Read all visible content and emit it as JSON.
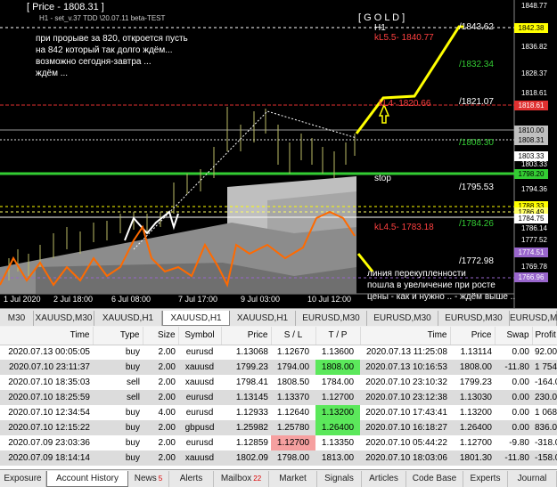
{
  "chart": {
    "header": "[ Price - 1808.31 ]",
    "subheader": "H1 - set_v.37 TDD \\20.07.11 beta-TEST",
    "symbol": "[ G O L D ]",
    "timeframe": "H1",
    "comment_lines": [
      "при прорыве за 820, откроется пусть",
      "на 842 который так долго ждём...",
      "возможно сегодня-завтра ...",
      "ждём ..."
    ],
    "bottom_comment_lines": [
      "линия перекупленности",
      "пошла в увеличение при росте",
      "цены - как и нужно .. - ждём выше .."
    ],
    "stop_label": "stop",
    "levels": [
      {
        "text": "kL5.5- 1840.77",
        "color": "#ff4040"
      },
      {
        "text": "/1843.62",
        "color": "#ffffff"
      },
      {
        "text": "/1832.34",
        "color": "#33cc33"
      },
      {
        "text": "kL4- 1820.66",
        "color": "#ff4040"
      },
      {
        "text": "/1821.07",
        "color": "#ffffff"
      },
      {
        "text": "/1808.30",
        "color": "#33cc33"
      },
      {
        "text": "/1795.53",
        "color": "#ffffff"
      },
      {
        "text": "kL4.5- 1783.18",
        "color": "#ff4040"
      },
      {
        "text": "/1784.26",
        "color": "#33cc33"
      },
      {
        "text": "/1772.98",
        "color": "#ffffff"
      }
    ],
    "price_axis": [
      "1848.77",
      "1836.82",
      "1828.37",
      "1818.61",
      "1803.33",
      "1794.36",
      "1786.14",
      "1777.52",
      "1769.78"
    ],
    "price_boxes": [
      {
        "text": "1842.38",
        "bg": "#ffff00"
      },
      {
        "text": "1818.61",
        "bg": "#e03030"
      },
      {
        "text": "1810.00",
        "bg": "#c0c0c0"
      },
      {
        "text": "1808.31",
        "bg": "#c0c0c0"
      },
      {
        "text": "1803.33",
        "bg": "#ffffff"
      },
      {
        "text": "1798.20",
        "bg": "#33cc33"
      },
      {
        "text": "1788.33",
        "bg": "#ffff00"
      },
      {
        "text": "1786.49",
        "bg": "#ffff66"
      },
      {
        "text": "1784.75",
        "bg": "#ffffff"
      },
      {
        "text": "1774.51",
        "bg": "#9966cc"
      },
      {
        "text": "1766.96",
        "bg": "#9966cc"
      }
    ],
    "time_axis": [
      "1 Jul 2020",
      "2 Jul 18:00",
      "6 Jul 08:00",
      "7 Jul 17:00",
      "9 Jul 03:00",
      "10 Jul 12:00"
    ]
  },
  "chart_tabs": [
    {
      "label": "M30",
      "active": false
    },
    {
      "label": "XAUUSD,M30",
      "active": false
    },
    {
      "label": "XAUUSD,H1",
      "active": false
    },
    {
      "label": "XAUUSD,H1",
      "active": true
    },
    {
      "label": "XAUUSD,H1",
      "active": false
    },
    {
      "label": "EURUSD,M30",
      "active": false
    },
    {
      "label": "EURUSD,M30",
      "active": false
    },
    {
      "label": "EURUSD,M30",
      "active": false
    },
    {
      "label": "EURUSD,M3",
      "active": false
    }
  ],
  "history": {
    "columns": [
      "Time",
      "Type",
      "Size",
      "Symbol",
      "Price",
      "S / L",
      "T / P",
      "Time",
      "Price",
      "Swap",
      "Profit"
    ],
    "rows": [
      [
        "2020.07.13 00:05:05",
        "buy",
        "2.00",
        "eurusd",
        "1.13068",
        "1.12670",
        "1.13600",
        "2020.07.13 11:25:08",
        "1.13114",
        "0.00",
        "92.00"
      ],
      [
        "2020.07.10 23:11:37",
        "buy",
        "2.00",
        "xauusd",
        "1799.23",
        "1794.00",
        "1808.00",
        "2020.07.13 10:16:53",
        "1808.00",
        "-11.80",
        "1 754.00"
      ],
      [
        "2020.07.10 18:35:03",
        "sell",
        "2.00",
        "xauusd",
        "1798.41",
        "1808.50",
        "1784.00",
        "2020.07.10 23:10:32",
        "1799.23",
        "0.00",
        "-164.00"
      ],
      [
        "2020.07.10 18:25:59",
        "sell",
        "2.00",
        "eurusd",
        "1.13145",
        "1.13370",
        "1.12700",
        "2020.07.10 23:12:38",
        "1.13030",
        "0.00",
        "230.00"
      ],
      [
        "2020.07.10 12:34:54",
        "buy",
        "4.00",
        "eurusd",
        "1.12933",
        "1.12640",
        "1.13200",
        "2020.07.10 17:43:41",
        "1.13200",
        "0.00",
        "1 068.00"
      ],
      [
        "2020.07.10 12:15:22",
        "buy",
        "2.00",
        "gbpusd",
        "1.25982",
        "1.25780",
        "1.26400",
        "2020.07.10 16:18:27",
        "1.26400",
        "0.00",
        "836.00"
      ],
      [
        "2020.07.09 23:03:36",
        "buy",
        "2.00",
        "eurusd",
        "1.12859",
        "1.12700",
        "1.13350",
        "2020.07.10 05:44:22",
        "1.12700",
        "-9.80",
        "-318.00"
      ],
      [
        "2020.07.09 18:14:14",
        "buy",
        "2.00",
        "xauusd",
        "1802.09",
        "1798.00",
        "1813.00",
        "2020.07.10 18:03:06",
        "1801.30",
        "-11.80",
        "-158.00"
      ]
    ],
    "highlights": {
      "green": "#5be85b",
      "red": "#f6a0a0"
    }
  },
  "terminal_tabs": [
    {
      "label": "Exposure",
      "badge": ""
    },
    {
      "label": "Account History",
      "badge": ""
    },
    {
      "label": "News",
      "badge": "5"
    },
    {
      "label": "Alerts",
      "badge": ""
    },
    {
      "label": "Mailbox",
      "badge": "22"
    },
    {
      "label": "Market",
      "badge": ""
    },
    {
      "label": "Signals",
      "badge": ""
    },
    {
      "label": "Articles",
      "badge": ""
    },
    {
      "label": "Code Base",
      "badge": ""
    },
    {
      "label": "Experts",
      "badge": ""
    },
    {
      "label": "Journal",
      "badge": ""
    }
  ]
}
